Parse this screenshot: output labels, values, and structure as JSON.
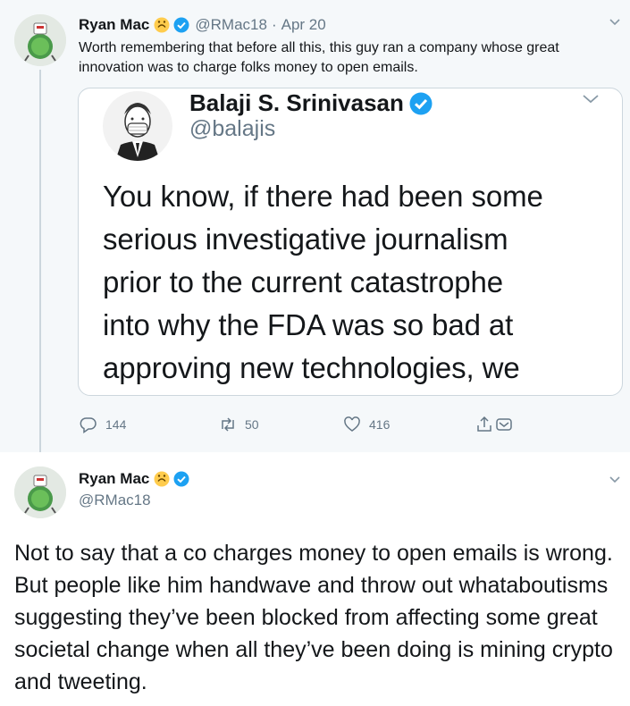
{
  "tweet1": {
    "name": "Ryan Mac",
    "handle": "@RMac18",
    "separator": "·",
    "date": "Apr 20",
    "text": "Worth remembering that before all this, this guy ran a company whose great innovation was to charge folks money to open emails.",
    "emoji": "upside-down-face-emoji",
    "verified_icon": "verified-badge-icon",
    "quoted": {
      "name": "Balaji S. Srinivasan",
      "handle": "@balajis",
      "lines": [
        "You know, if there had been some",
        "serious investigative journalism",
        "prior to the current catastrophe",
        "into why the FDA was so bad at",
        "approving new technologies, we"
      ]
    },
    "actions": {
      "replies": "144",
      "retweets": "50",
      "likes": "416"
    }
  },
  "tweet2": {
    "name": "Ryan Mac",
    "handle": "@RMac18",
    "text": "Not to say that a co charges money to open emails is wrong. But people like him handwave and throw out whataboutisms suggesting they’ve been blocked from affecting some great societal change when all they’ve been doing is mining crypto and tweeting."
  },
  "colors": {
    "verified": "#1da1f2",
    "secondary_text": "#657786",
    "border": "#ccd6dd",
    "thread_bg": "#f5f8fa"
  }
}
